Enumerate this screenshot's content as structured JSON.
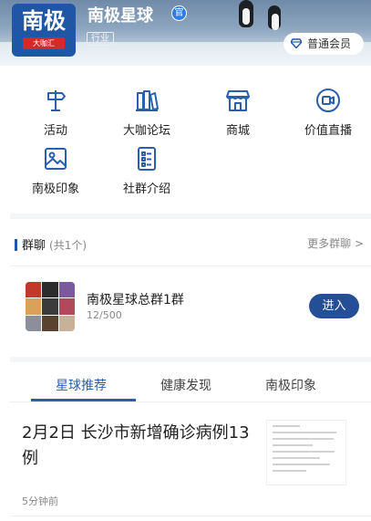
{
  "header": {
    "logo_text": "南极",
    "logo_sub": "大咖汇",
    "star_name": "南极星球",
    "official_badge": "官",
    "category_tag": "行业",
    "member_button": "普通会员"
  },
  "grid": [
    {
      "label": "活动",
      "icon": "signpost-icon"
    },
    {
      "label": "大咖论坛",
      "icon": "books-icon"
    },
    {
      "label": "商城",
      "icon": "store-icon"
    },
    {
      "label": "价值直播",
      "icon": "live-video-icon"
    },
    {
      "label": "南极印象",
      "icon": "image-icon"
    },
    {
      "label": "社群介绍",
      "icon": "list-doc-icon"
    }
  ],
  "group_chat": {
    "title": "群聊",
    "count": "(共1个)",
    "more": "更多群聊 >",
    "name": "南极星球总群1群",
    "members": "12/500",
    "enter": "进入"
  },
  "tabs": [
    "星球推荐",
    "健康发现",
    "南极印象"
  ],
  "article": {
    "title": "2月2日 长沙市新增确诊病例13例",
    "time": "5分钟前"
  },
  "colors": {
    "brand_blue": "#2a5fae",
    "button_blue": "#244f96",
    "logo_blue": "#1f56a6",
    "logo_red": "#d22a2a"
  }
}
